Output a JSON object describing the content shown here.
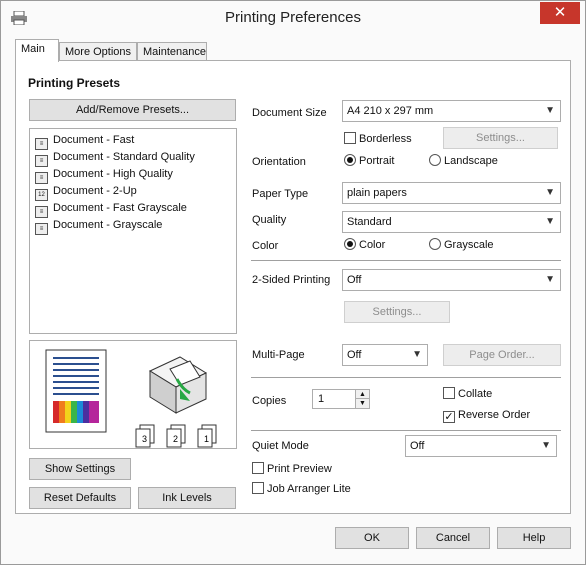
{
  "window": {
    "title": "Printing Preferences",
    "close_glyph": "✕"
  },
  "tabs": [
    {
      "label": "Main",
      "active": true
    },
    {
      "label": "More Options",
      "active": false
    },
    {
      "label": "Maintenance",
      "active": false
    }
  ],
  "presets": {
    "heading": "Printing Presets",
    "add_remove_label": "Add/Remove Presets...",
    "items": [
      {
        "label": "Document - Fast",
        "icon": "document-preset-icon",
        "glyph": "≡"
      },
      {
        "label": "Document - Standard Quality",
        "icon": "document-preset-icon",
        "glyph": "≡"
      },
      {
        "label": "Document - High Quality",
        "icon": "document-preset-icon",
        "glyph": "≡"
      },
      {
        "label": "Document - 2-Up",
        "icon": "two-up-icon",
        "glyph": "12"
      },
      {
        "label": "Document - Fast Grayscale",
        "icon": "document-preset-icon",
        "glyph": "≡"
      },
      {
        "label": "Document - Grayscale",
        "icon": "document-preset-icon",
        "glyph": "≡"
      }
    ]
  },
  "preview": {
    "copies_glyphs": [
      "3",
      "2",
      "1"
    ]
  },
  "left_buttons": {
    "show_settings": "Show Settings",
    "reset_defaults": "Reset Defaults",
    "ink_levels": "Ink Levels"
  },
  "settings": {
    "document_size": {
      "label": "Document Size",
      "value": "A4 210 x 297 mm"
    },
    "borderless": {
      "label": "Borderless",
      "checked": false
    },
    "borderless_settings": "Settings...",
    "orientation": {
      "label": "Orientation",
      "options": [
        "Portrait",
        "Landscape"
      ],
      "selected": "Portrait"
    },
    "paper_type": {
      "label": "Paper Type",
      "value": "plain papers"
    },
    "quality": {
      "label": "Quality",
      "value": "Standard"
    },
    "color": {
      "label": "Color",
      "options": [
        "Color",
        "Grayscale"
      ],
      "selected": "Color"
    },
    "two_sided": {
      "label": "2-Sided Printing",
      "value": "Off",
      "settings_label": "Settings..."
    },
    "multi_page": {
      "label": "Multi-Page",
      "value": "Off",
      "page_order_label": "Page Order..."
    },
    "copies": {
      "label": "Copies",
      "value": "1"
    },
    "collate": {
      "label": "Collate",
      "checked": false
    },
    "reverse_order": {
      "label": "Reverse Order",
      "checked": true
    },
    "quiet_mode": {
      "label": "Quiet Mode",
      "value": "Off"
    },
    "print_preview": {
      "label": "Print Preview",
      "checked": false
    },
    "job_arranger": {
      "label": "Job Arranger Lite",
      "checked": false
    }
  },
  "footer": {
    "ok": "OK",
    "cancel": "Cancel",
    "help": "Help"
  },
  "colors": {
    "close_red": "#c7362b",
    "button_gray": "#e1e1e1",
    "border": "#adadad"
  }
}
